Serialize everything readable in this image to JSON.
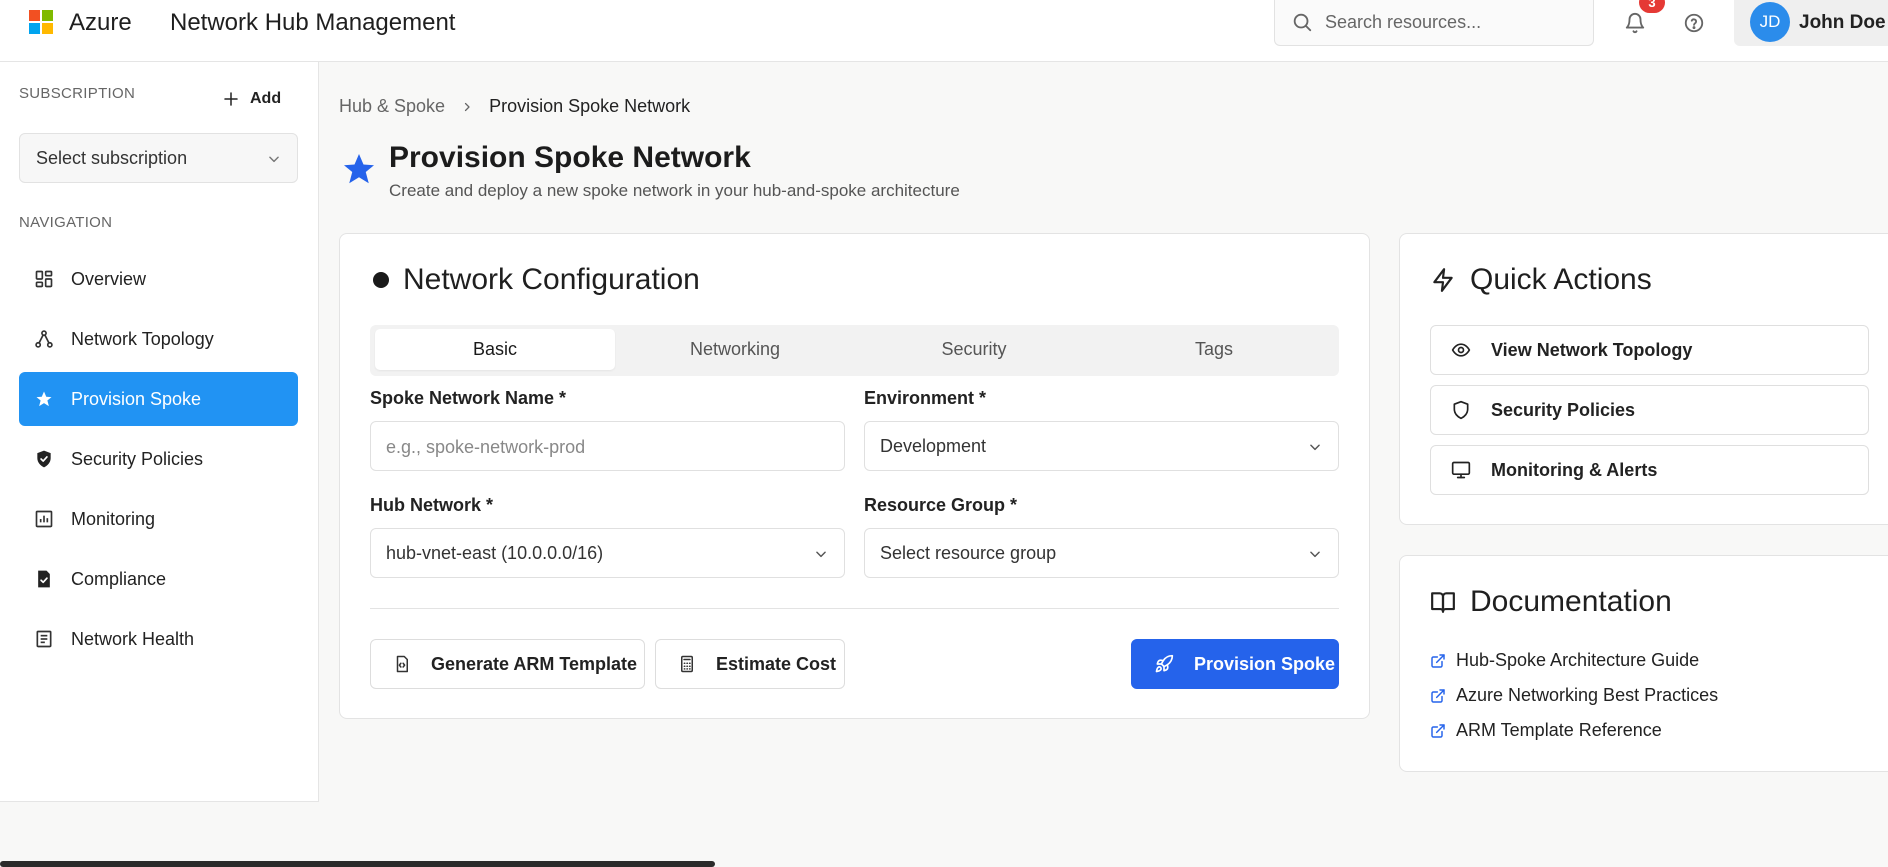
{
  "header": {
    "brand": "Azure",
    "app_title": "Network Hub Management",
    "search_placeholder": "Search resources...",
    "notification_count": "3",
    "user_initials": "JD",
    "user_name": "John Doe"
  },
  "sidebar": {
    "subscription_label": "SUBSCRIPTION",
    "add_label": "Add",
    "subscription_select": "Select subscription",
    "navigation_label": "NAVIGATION",
    "items": [
      {
        "label": "Overview",
        "icon": "grid-icon"
      },
      {
        "label": "Network Topology",
        "icon": "topology-icon"
      },
      {
        "label": "Provision Spoke",
        "icon": "star-icon",
        "active": true
      },
      {
        "label": "Security Policies",
        "icon": "shield-check-icon"
      },
      {
        "label": "Monitoring",
        "icon": "chart-icon"
      },
      {
        "label": "Compliance",
        "icon": "file-check-icon"
      },
      {
        "label": "Network Health",
        "icon": "list-icon"
      }
    ]
  },
  "breadcrumb": {
    "parent": "Hub & Spoke",
    "current": "Provision Spoke Network"
  },
  "page": {
    "title": "Provision Spoke Network",
    "subtitle": "Create and deploy a new spoke network in your hub-and-spoke architecture"
  },
  "config": {
    "title": "Network Configuration",
    "tabs": [
      "Basic",
      "Networking",
      "Security",
      "Tags"
    ],
    "active_tab": "Basic",
    "fields": {
      "spoke_name_label": "Spoke Network Name *",
      "spoke_name_placeholder": "e.g., spoke-network-prod",
      "environment_label": "Environment *",
      "environment_value": "Development",
      "hub_label": "Hub Network *",
      "hub_value": "hub-vnet-east (10.0.0.0/16)",
      "rg_label": "Resource Group *",
      "rg_value": "Select resource group"
    },
    "buttons": {
      "arm": "Generate ARM Template",
      "cost": "Estimate Cost",
      "provision": "Provision Spoke"
    }
  },
  "quick_actions": {
    "title": "Quick Actions",
    "items": [
      "View Network Topology",
      "Security Policies",
      "Monitoring & Alerts"
    ]
  },
  "documentation": {
    "title": "Documentation",
    "links": [
      "Hub-Spoke Architecture Guide",
      "Azure Networking Best Practices",
      "ARM Template Reference"
    ]
  },
  "colors": {
    "accent": "#2563eb",
    "active_nav": "#2193f3",
    "badge": "#e53935",
    "link_icon": "#2563eb"
  }
}
